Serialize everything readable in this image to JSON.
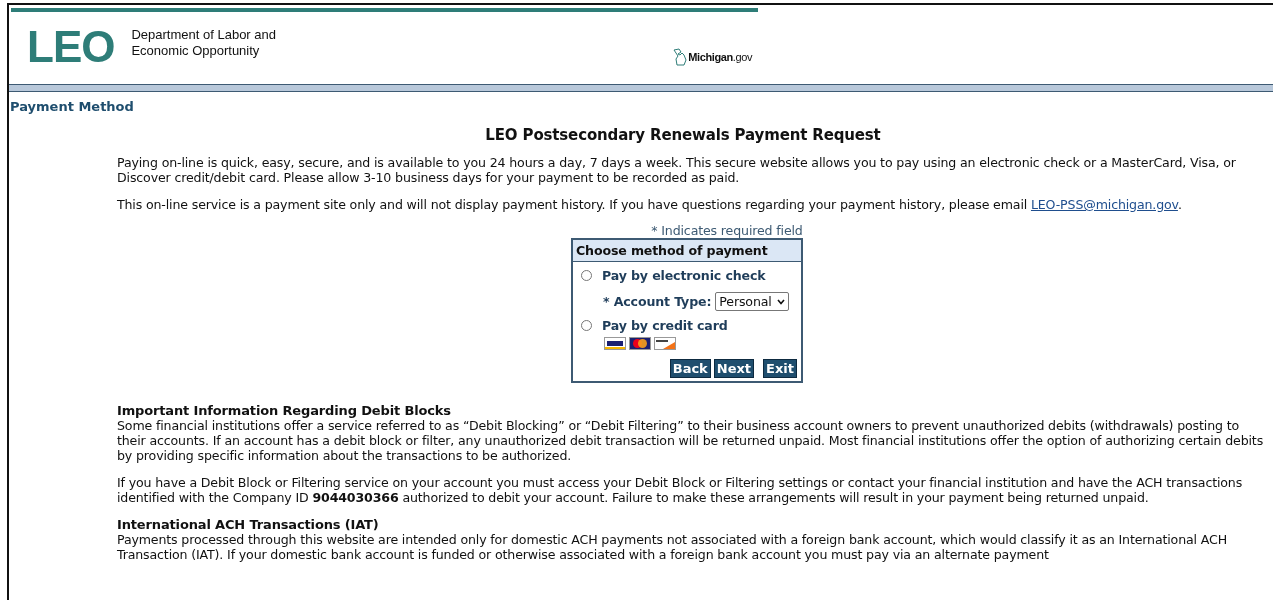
{
  "header": {
    "logo": "LEO",
    "department": "Department of Labor and Economic Opportunity",
    "state_site": "**Michigan**.gov"
  },
  "section_title": "Payment Method",
  "page_title": "LEO Postsecondary Renewals Payment Request",
  "intro": "Paying on-line is quick, easy, secure, and is available to you 24 hours a day, 7 days a week. This secure website allows you to pay using an electronic check or a MasterCard, Visa, or Discover credit/debit card. Please allow 3-10 business days for your payment to be recorded as paid.",
  "notice": {
    "text": "This on-line service is a payment site only and will not display payment history. If you have questions regarding your payment history, please email ",
    "link": "LEO-PSS@michigan.gov",
    "after": "."
  },
  "required_note": "* Indicates required field",
  "payment_form": {
    "title": "Choose method of payment",
    "options": [
      {
        "label": "Pay by electronic check",
        "selected": false,
        "kind": "check"
      },
      {
        "label": "Pay by credit card",
        "selected": false,
        "kind": "card"
      }
    ],
    "account_type": {
      "label": "* Account Type:",
      "value": "Personal"
    },
    "buttons": [
      "Back",
      "Next",
      "Exit"
    ]
  },
  "sections": [
    {
      "heading": "Important Information Regarding Debit Blocks",
      "paragraphs": [
        "Some financial institutions offer a service referred to as “Debit Blocking” or “Debit Filtering” to their business account owners to prevent unauthorized debits (withdrawals) posting to their accounts. If an account has a debit block or filter, any unauthorized debit transaction will be returned unpaid.  Most financial institutions offer the option of authorizing certain debits by providing specific information about the transactions to be authorized.",
        "If you have a Debit Block or Filtering service on your account you must access your Debit Block or Filtering settings or contact your financial institution and have the ACH transactions identified with the Company ID **9044030366** authorized to debit your account.  Failure to make these arrangements will result in your payment being returned unpaid."
      ]
    },
    {
      "heading": "International ACH Transactions (IAT)",
      "paragraphs": [
        "Payments processed through this website are intended only for domestic ACH payments not associated with a foreign bank account, which would classify it as an International ACH Transaction (IAT). If your domestic bank account is funded or otherwise associated with a foreign bank account you must pay via an alternate payment"
      ]
    }
  ]
}
